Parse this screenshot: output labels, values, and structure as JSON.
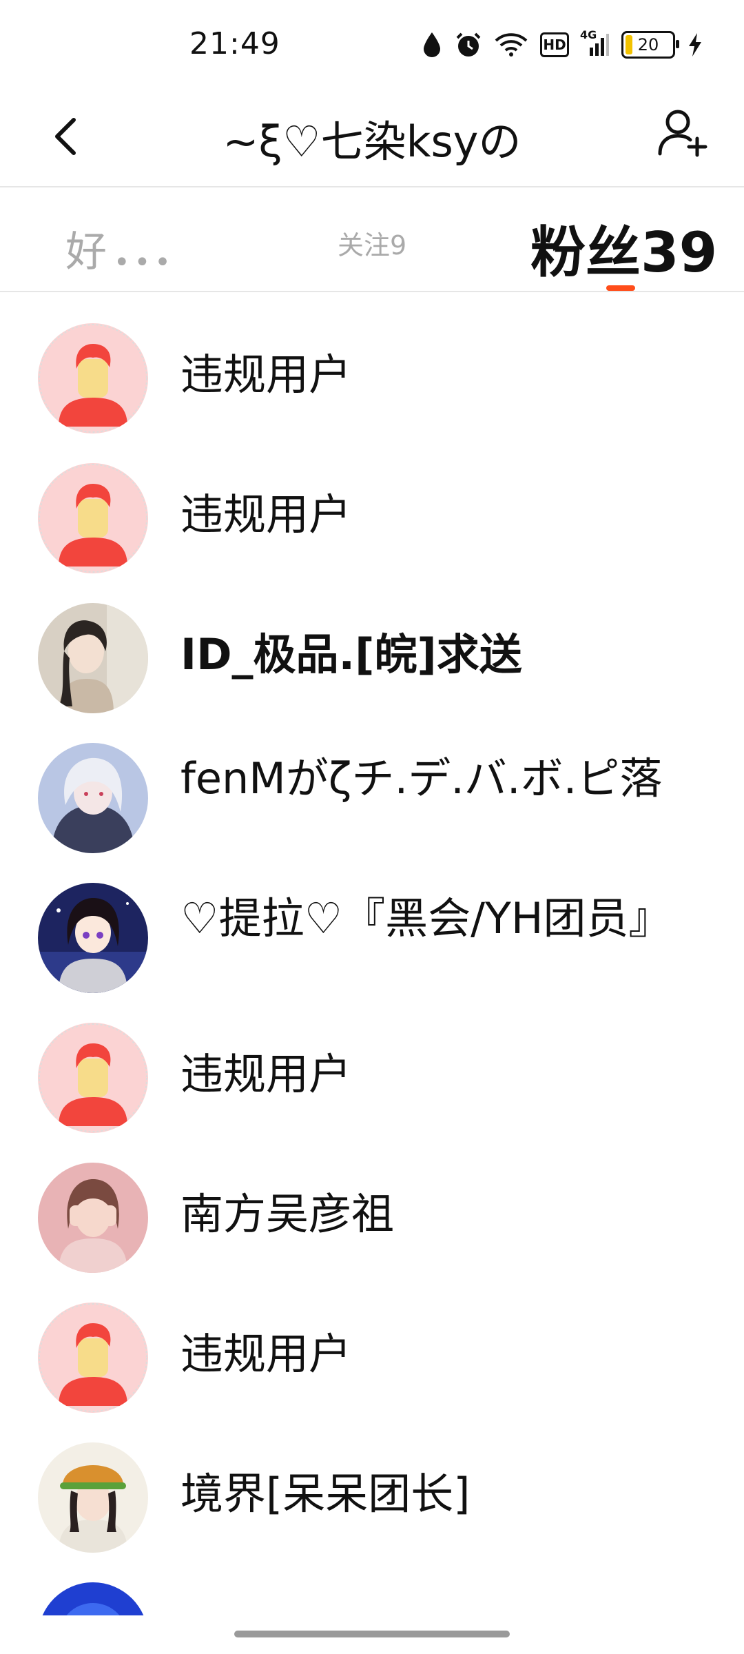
{
  "status_bar": {
    "time": "21:49",
    "network": "4G",
    "hd": "HD",
    "battery": "20",
    "icons": [
      "water-drop-icon",
      "alarm-icon",
      "wifi-icon",
      "hd-icon",
      "signal-icon",
      "battery-icon",
      "charging-icon"
    ]
  },
  "header": {
    "title": "~ξ♡七染ksyの",
    "back_icon": "chevron-left-icon",
    "add_friend_icon": "add-user-icon"
  },
  "tabs": {
    "friends": "好",
    "friends_more": "•••",
    "following": "关注9",
    "fans": "粉丝39"
  },
  "fans": [
    {
      "name": "违规用户",
      "avatar": "default"
    },
    {
      "name": "违规用户",
      "avatar": "default"
    },
    {
      "name": "ID_极品.[皖]求送",
      "avatar": "photo-girl-1"
    },
    {
      "name": "fenMがζチ.デ.バ.ボ.ピ落",
      "avatar": "photo-girl-2"
    },
    {
      "name": "♡提拉♡『黑会/YH团员』",
      "avatar": "photo-anime"
    },
    {
      "name": "违规用户",
      "avatar": "default"
    },
    {
      "name": "南方吴彦祖",
      "avatar": "photo-girl-3"
    },
    {
      "name": "违规用户",
      "avatar": "default"
    },
    {
      "name": "境界[呆呆团长]",
      "avatar": "photo-girl-4"
    },
    {
      "name": "",
      "avatar": "photo-blue"
    }
  ],
  "colors": {
    "accent": "#ff4d1a",
    "default_avatar_bg": "#fbd3d3",
    "default_avatar_hair": "#f2453d",
    "default_avatar_face": "#f7dc8a"
  }
}
